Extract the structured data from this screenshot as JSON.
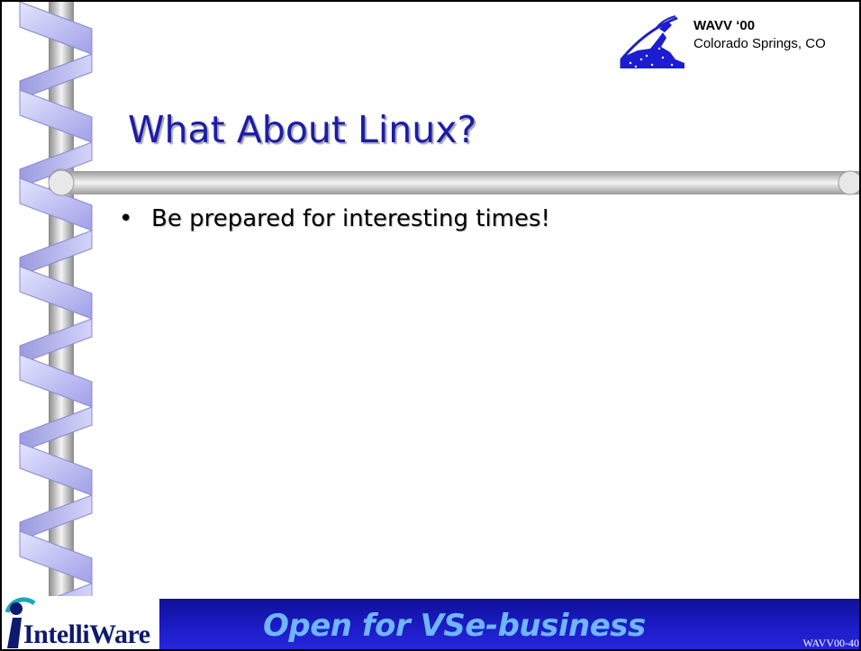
{
  "conference": {
    "name": "WAVV ‘00",
    "location": "Colorado Springs, CO",
    "logo_icon": "mountain-logo-icon"
  },
  "slide": {
    "title": "What About Linux?",
    "bullets": [
      "Be prepared for interesting times!"
    ]
  },
  "footer": {
    "tagline": "Open for VSe-business",
    "slide_id": "WAVV00-40",
    "company_name": "IntelliWare",
    "company_logo_icon": "intelliware-logo-icon"
  },
  "colors": {
    "title": "#1c1ca8",
    "ribbon": "#b8b8f2",
    "footer_bar": "#1c1cc8",
    "tagline": "#6fb6ff"
  }
}
